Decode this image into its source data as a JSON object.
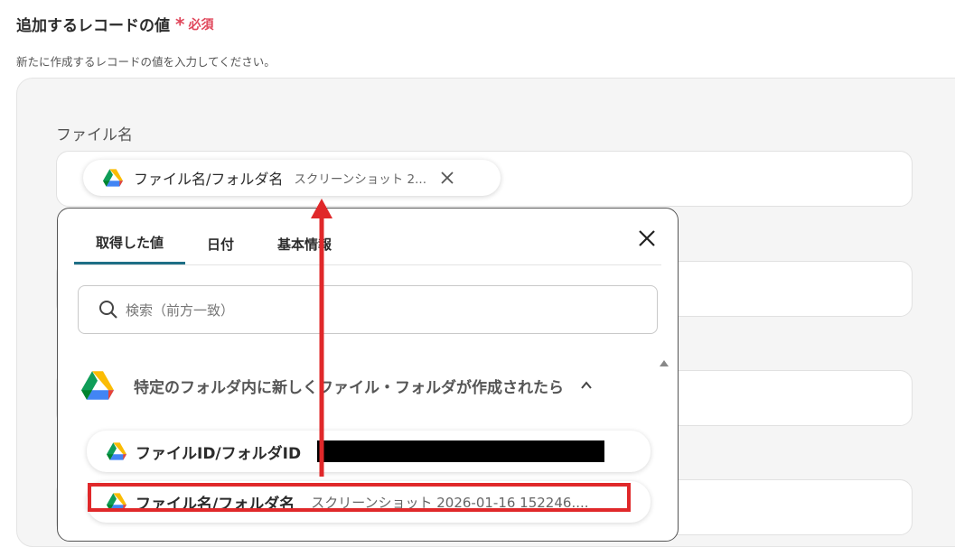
{
  "section": {
    "title": "追加するレコードの値",
    "required_star": "*",
    "required_label": "必須",
    "description": "新たに作成するレコードの値を入力してください。"
  },
  "field": {
    "label": "ファイル名",
    "chip": {
      "name": "ファイル名/フォルダ名",
      "value": "スクリーンショット 2..."
    }
  },
  "popup": {
    "tabs": [
      {
        "label": "取得した値",
        "active": true
      },
      {
        "label": "日付",
        "active": false
      },
      {
        "label": "基本情報",
        "active": false
      }
    ],
    "search_placeholder": "検索（前方一致）",
    "group_title": "特定のフォルダ内に新しくファイル・フォルダが作成されたら",
    "items": [
      {
        "name": "ファイルID/フォルダID",
        "value": "",
        "redacted": true
      },
      {
        "name": "ファイル名/フォルダ名",
        "value": "スクリーンショット 2026-01-16 152246....",
        "highlighted": true
      }
    ]
  },
  "colors": {
    "required": "#e0475b",
    "tab_active": "#1e6f86",
    "annotation_red": "#e0282a"
  },
  "icons": [
    "google-drive-icon",
    "close-icon",
    "search-icon",
    "chevron-up-icon",
    "scroll-up-arrow-icon"
  ]
}
